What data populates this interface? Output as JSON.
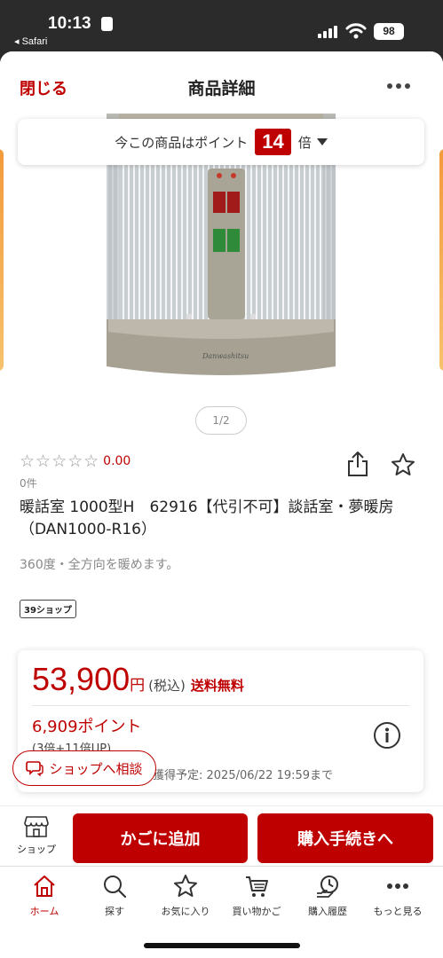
{
  "status_bar": {
    "time": "10:13",
    "back_label": "◂ Safari",
    "battery": "98"
  },
  "nav": {
    "close_label": "閉じる",
    "title": "商品詳細"
  },
  "points_banner": {
    "prefix": "今この商品はポイント",
    "multiplier": "14",
    "suffix": "倍"
  },
  "hero": {
    "pager": "1/2",
    "brand_text": "Danwashitsu"
  },
  "product": {
    "stars": "☆☆☆☆☆",
    "rating": "0.00",
    "review_count": "0件",
    "title": "暖話室 1000型H　62916【代引不可】談話室・夢暖房（DAN1000-R16）",
    "description": "360度・全方向を暖めます。",
    "shop_tag": "39ショップ"
  },
  "price": {
    "amount": "53,900",
    "yen": "円",
    "tax": "(税込)",
    "shipping": "送料無料",
    "points": "6,909ポイント",
    "points_detail": "(3倍+11倍UP)",
    "deadline": "獲得予定: 2025/06/22 19:59まで"
  },
  "consult_label": "ショップへ相談",
  "actions": {
    "shop_label": "ショップ",
    "cart_label": "かごに追加",
    "buy_label": "購入手続きへ"
  },
  "tabs": [
    {
      "label": "ホーム",
      "icon": "home-icon"
    },
    {
      "label": "探す",
      "icon": "search-icon"
    },
    {
      "label": "お気に入り",
      "icon": "star-icon"
    },
    {
      "label": "買い物かご",
      "icon": "cart-icon"
    },
    {
      "label": "購入履歴",
      "icon": "history-icon"
    },
    {
      "label": "もっと見る",
      "icon": "more-icon"
    }
  ],
  "colors": {
    "accent": "#bf0000"
  }
}
